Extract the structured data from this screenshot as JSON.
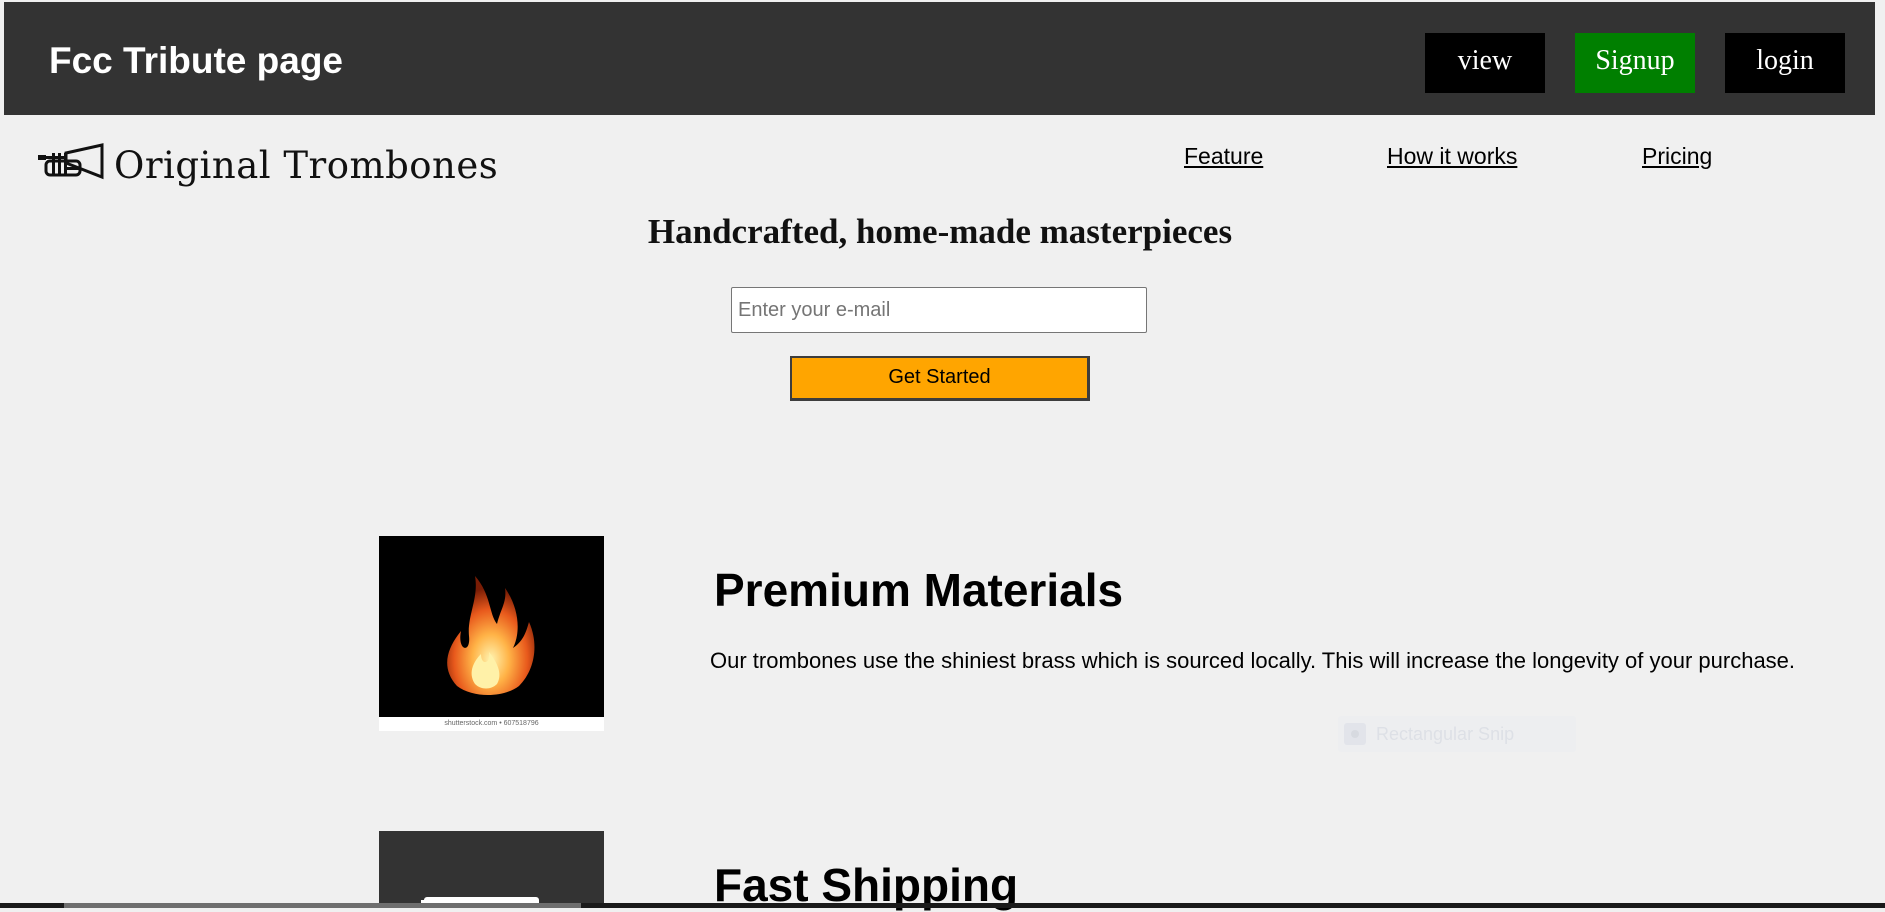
{
  "header": {
    "title": "Fcc Tribute page",
    "buttons": {
      "view": "view",
      "signup": "Signup",
      "login": "login"
    },
    "colors": {
      "background": "#333333",
      "signup": "#007f00",
      "view_login": "#000000"
    }
  },
  "nav": {
    "logo_text": "Original Trombones",
    "logo_icon": "trumpet-icon",
    "links": {
      "feature": "Feature",
      "how_it_works": "How it works",
      "pricing": "Pricing"
    }
  },
  "hero": {
    "title": "Handcrafted, home-made masterpieces",
    "email_placeholder": "Enter your e-mail",
    "cta_label": "Get Started",
    "cta_color": "#ffa500"
  },
  "features": [
    {
      "heading": "Premium Materials",
      "description": "Our trombones use the shiniest brass which is sourced locally. This will increase the longevity of your purchase.",
      "image": "fire-image",
      "image_caption": "shutterstock.com • 607518796"
    },
    {
      "heading": "Fast Shipping",
      "image": "truck-image"
    }
  ],
  "overlay": {
    "snip_label": "Rectangular Snip"
  }
}
